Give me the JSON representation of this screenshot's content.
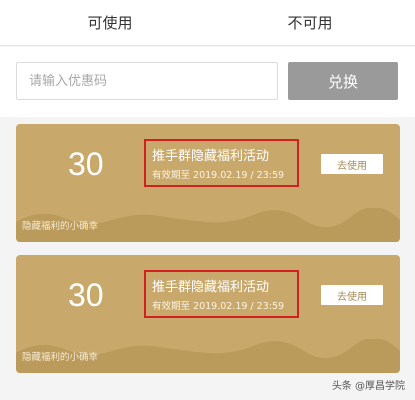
{
  "tabs": [
    {
      "label": "可使用"
    },
    {
      "label": "不可用"
    }
  ],
  "code": {
    "placeholder": "请输入优惠码",
    "value": "",
    "button_label": "兑换"
  },
  "coupons": [
    {
      "amount": "30",
      "title": "推手群隐藏福利活动",
      "validity": "有效期至 2019.02.19 / 23:59",
      "button_label": "去使用",
      "note": "隐藏福利的小确幸"
    },
    {
      "amount": "30",
      "title": "推手群隐藏福利活动",
      "validity": "有效期至 2019.02.19 / 23:59",
      "button_label": "去使用",
      "note": "隐藏福利的小确幸"
    }
  ],
  "colors": {
    "coupon_bg": "#c9a96b",
    "highlight_border": "#d21f1f",
    "redeem_button": "#9a9a9a"
  },
  "watermark": "头条 @厚昌学院"
}
